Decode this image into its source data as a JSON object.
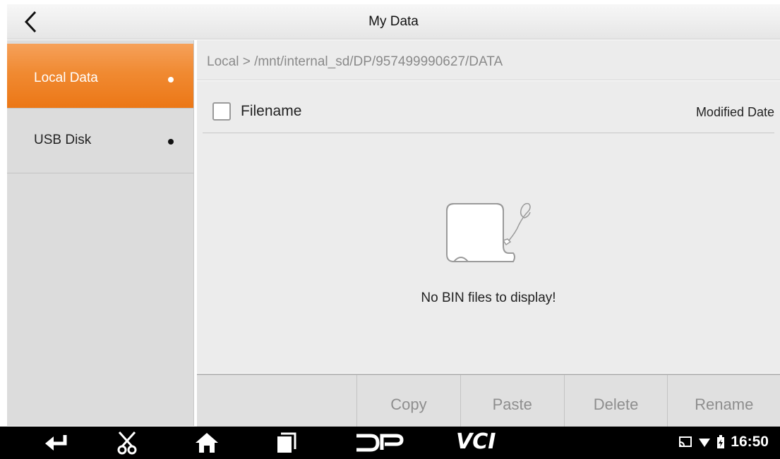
{
  "header": {
    "title": "My Data",
    "back_icon": "chevron-left-icon"
  },
  "sidebar": {
    "items": [
      {
        "label": "Local Data",
        "active": true
      },
      {
        "label": "USB Disk",
        "active": false
      }
    ],
    "active_color": "#ec7716"
  },
  "path": {
    "text": "Local > /mnt/internal_sd/DP/957499990627/DATA"
  },
  "list": {
    "columns": {
      "filename": "Filename",
      "modified": "Modified Date"
    },
    "empty_message": "No BIN files to display!",
    "empty_icon": "empty-document-icon"
  },
  "toolbar": {
    "copy_label": "Copy",
    "paste_label": "Paste",
    "delete_label": "Delete",
    "rename_label": "Rename"
  },
  "navbar": {
    "icons": [
      "back-arrow-icon",
      "scissors-icon",
      "home-icon",
      "recent-apps-icon",
      "dp-logo-icon",
      "vci-logo-icon"
    ],
    "logo_dp": "DP",
    "logo_vci": "VCI",
    "status": {
      "time": "16:50",
      "icons": [
        "cast-icon",
        "wifi-icon",
        "battery-icon"
      ]
    }
  }
}
